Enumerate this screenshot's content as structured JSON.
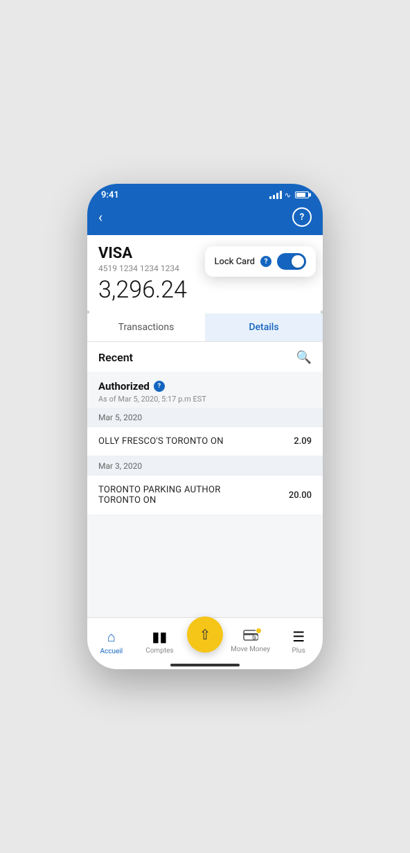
{
  "statusBar": {
    "time": "9:41"
  },
  "account": {
    "type": "VISA",
    "number": "4519 1234 1234 1234",
    "balance": "3,296.24"
  },
  "lockCard": {
    "label": "Lock Card",
    "isOn": true
  },
  "tabs": [
    {
      "id": "transactions",
      "label": "Transactions",
      "active": false
    },
    {
      "id": "details",
      "label": "Details",
      "active": true
    }
  ],
  "recent": {
    "title": "Recent"
  },
  "authorized": {
    "label": "Authorized",
    "date": "As of Mar 5, 2020, 5:17 p.m EST"
  },
  "transactions": [
    {
      "date": "Mar 5, 2020",
      "items": [
        {
          "name": "OLLY FRESCO'S TORONTO ON",
          "amount": "2.09"
        }
      ]
    },
    {
      "date": "Mar 3, 2020",
      "items": [
        {
          "name": "TORONTO PARKING AUTHOR\nTORONTO ON",
          "amount": "20.00"
        }
      ]
    }
  ],
  "bottomNav": {
    "home": "Accueil",
    "accounts": "Comptes",
    "moveMoney": "Move Money",
    "plus": "Plus"
  }
}
